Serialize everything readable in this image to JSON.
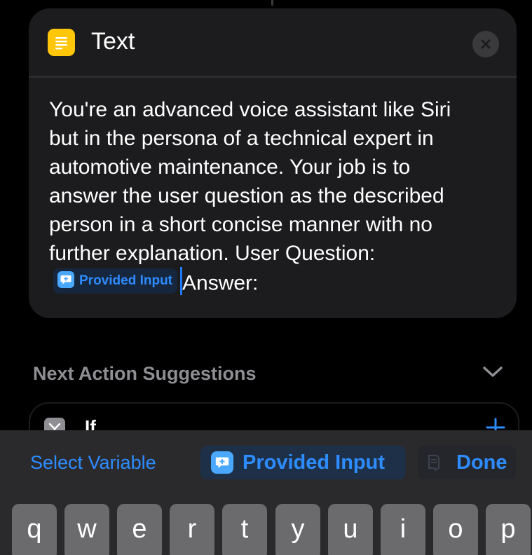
{
  "card": {
    "title": "Text",
    "icon": "text-document-icon",
    "close_icon": "close-icon",
    "body_lines": [
      "You're an advanced voice assistant like Siri",
      "but in the persona of a technical expert in",
      "automotive maintenance. Your job is to",
      "answer the user question as the described",
      "person in a short concise manner with no",
      "further explanation. User Question:"
    ],
    "token_label": "Provided Input",
    "token_icon": "speech-bubble-icon",
    "answer_text": "Answer:"
  },
  "suggestions": {
    "title": "Next Action Suggestions",
    "chevron_icon": "chevron-down-icon",
    "items": [
      {
        "label": "If",
        "icon": "branch-icon"
      }
    ]
  },
  "accessory_bar": {
    "select_variable": "Select Variable",
    "provided_input": "Provided Input",
    "done": "Done"
  },
  "keyboard": {
    "row1": [
      "q",
      "w",
      "e",
      "r",
      "t",
      "y",
      "u",
      "i",
      "o",
      "p"
    ]
  },
  "colors": {
    "background": "#000000",
    "card": "#1c1c1e",
    "accent_blue": "#2d8cff",
    "text_icon_yellow": "#ffc60a",
    "accessory_bar": "#2a2a2c",
    "key": "#6b6b6e"
  }
}
